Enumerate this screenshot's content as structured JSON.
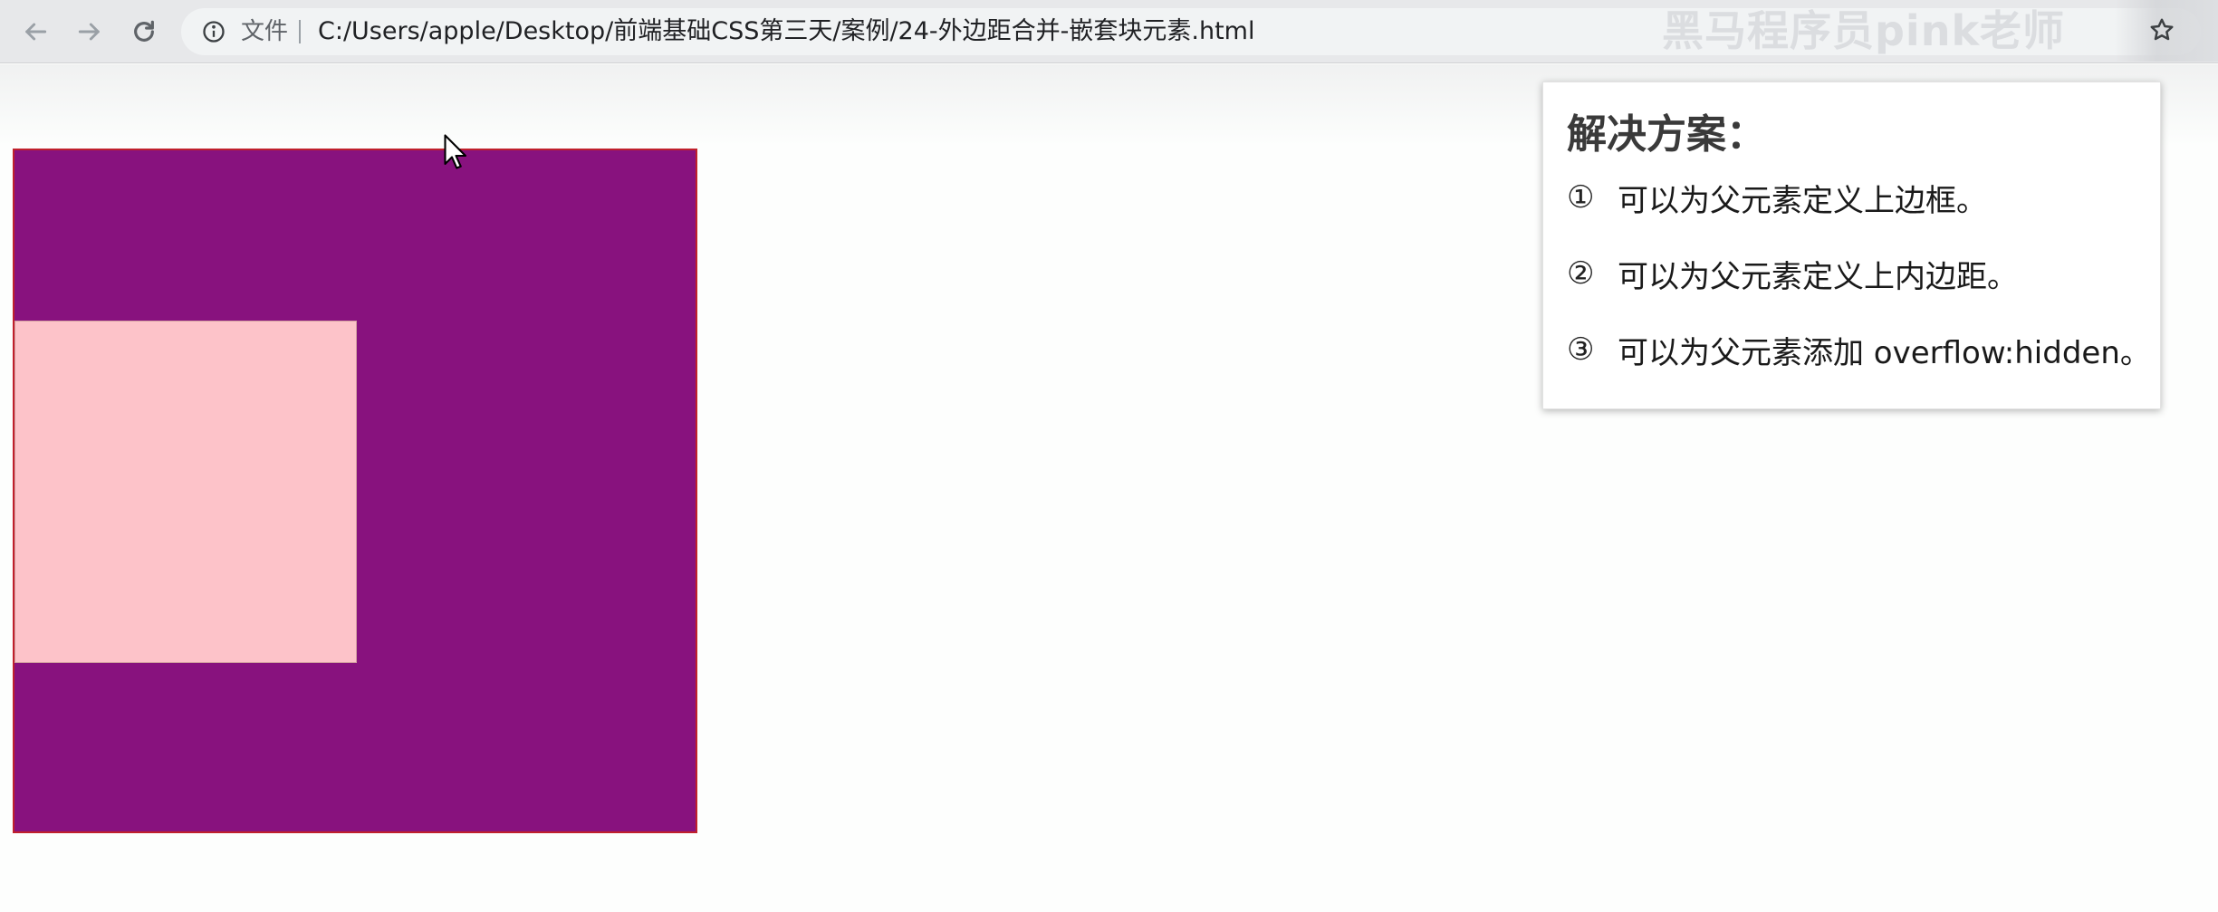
{
  "browser": {
    "file_label": "文件",
    "url": "C:/Users/apple/Desktop/前端基础CSS第三天/案例/24-外边距合并-嵌套块元素.html",
    "watermark": "黑马程序员pink老师",
    "nav_icons": [
      "back-arrow-icon",
      "forward-arrow-icon",
      "reload-icon"
    ],
    "info_icon": "info-icon",
    "bookmark_icon": "star-icon"
  },
  "page": {
    "colors": {
      "father_bg": "#88127e",
      "father_border": "#c0202c",
      "son_bg": "#fdc3c9"
    }
  },
  "panel": {
    "title": "解决方案：",
    "items": [
      {
        "num": "①",
        "text": "可以为父元素定义上边框。"
      },
      {
        "num": "②",
        "text": "可以为父元素定义上内边距。"
      },
      {
        "num": "③",
        "text": "可以为父元素添加 overflow:hidden。"
      }
    ]
  }
}
